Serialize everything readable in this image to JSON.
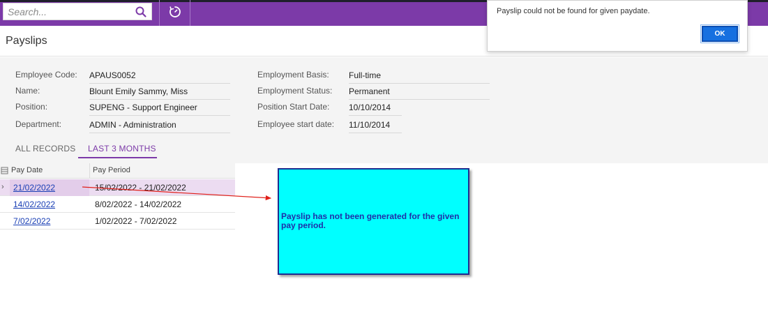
{
  "topbar": {
    "search_placeholder": "Search...",
    "search_icon": "search-icon",
    "history_icon": "timer-history-icon",
    "bar_color": "#7c3aa8"
  },
  "page": {
    "title": "Payslips"
  },
  "employee": {
    "code_label": "Employee Code:",
    "code_value": "APAUS0052",
    "name_label": "Name:",
    "name_value": "Blount Emily Sammy, Miss",
    "position_label": "Position:",
    "position_value": "SUPENG - Support Engineer",
    "department_label": "Department:",
    "department_value": "ADMIN - Administration",
    "basis_label": "Employment Basis:",
    "basis_value": "Full-time",
    "status_label": "Employment Status:",
    "status_value": "Permanent",
    "position_start_label": "Position Start Date:",
    "position_start_value": "10/10/2014",
    "employee_start_label": "Employee start date:",
    "employee_start_value": "11/10/2014"
  },
  "tabs": [
    {
      "label": "ALL RECORDS",
      "active": false
    },
    {
      "label": "LAST 3 MONTHS",
      "active": true
    }
  ],
  "grid": {
    "columns": [
      "Pay Date",
      "Pay Period"
    ],
    "rows": [
      {
        "pay_date": "21/02/2022",
        "pay_period": "15/02/2022 - 21/02/2022",
        "selected": true
      },
      {
        "pay_date": "14/02/2022",
        "pay_period": "8/02/2022 - 14/02/2022",
        "selected": false
      },
      {
        "pay_date": "7/02/2022",
        "pay_period": "1/02/2022 - 7/02/2022",
        "selected": false
      }
    ]
  },
  "callout": {
    "text": "Payslip has not been generated for the given pay period.",
    "bg_color": "#00ffff"
  },
  "dialog": {
    "message": "Payslip could not be found for given paydate.",
    "ok_label": "OK",
    "button_color": "#1670e0"
  }
}
